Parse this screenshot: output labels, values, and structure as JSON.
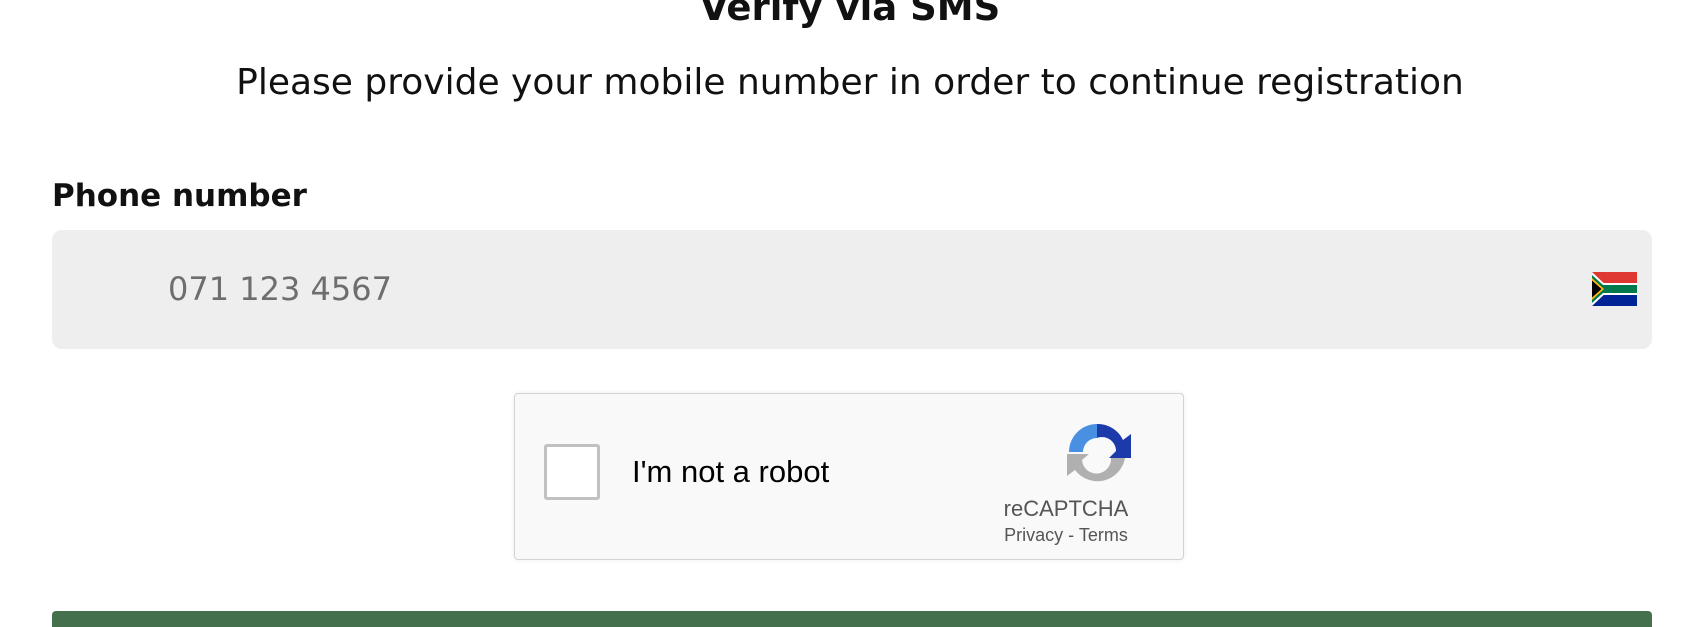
{
  "header": {
    "title": "Verify via SMS",
    "subtitle": "Please provide your mobile number in order to continue registration"
  },
  "phone": {
    "label": "Phone number",
    "placeholder": "071 123 4567",
    "value": "",
    "country_flag_icon": "south-africa-flag-icon"
  },
  "recaptcha": {
    "checkbox_label": "I'm not a robot",
    "checked": false,
    "brand": "reCAPTCHA",
    "privacy_link": "Privacy",
    "separator": "-",
    "terms_link": "Terms",
    "logo_icon": "recaptcha-logo-icon"
  },
  "colors": {
    "primary_button": "#44704e",
    "input_background": "#eeeeee",
    "text": "#111111"
  }
}
